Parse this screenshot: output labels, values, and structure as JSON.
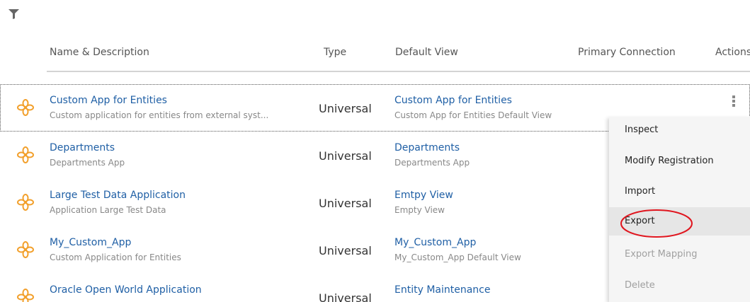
{
  "toolbar": {
    "filter_icon": "filter-icon"
  },
  "table": {
    "headers": {
      "name": "Name & Description",
      "type": "Type",
      "view": "Default View",
      "connection": "Primary Connection",
      "actions": "Actions"
    },
    "rows": [
      {
        "name": "Custom App for Entities",
        "description": "Custom application for entities from external syst...",
        "type": "Universal",
        "view_name": "Custom App for Entities",
        "view_description": "Custom App for Entities Default View",
        "selected": true
      },
      {
        "name": "Departments",
        "description": "Departments App",
        "type": "Universal",
        "view_name": "Departments",
        "view_description": "Departments App"
      },
      {
        "name": "Large Test Data Application",
        "description": "Application Large Test Data",
        "type": "Universal",
        "view_name": "Emtpy View",
        "view_description": "Empty View"
      },
      {
        "name": "My_Custom_App",
        "description": "Custom Application for Entities",
        "type": "Universal",
        "view_name": "My_Custom_App",
        "view_description": "My_Custom_App Default View"
      },
      {
        "name": "Oracle Open World Application",
        "description": "",
        "type": "Universal",
        "view_name": "Entity Maintenance",
        "view_description": ""
      }
    ],
    "app_icon": "flower-app-icon",
    "actions_icon": "kebab-menu-icon"
  },
  "context_menu": {
    "items": [
      {
        "label": "Inspect",
        "disabled": false
      },
      {
        "label": "Modify Registration",
        "disabled": false
      },
      {
        "label": "Import",
        "disabled": false
      },
      {
        "label": "Export",
        "disabled": false,
        "highlighted": true
      },
      {
        "label": "Export Mapping",
        "disabled": true
      },
      {
        "label": "Delete",
        "disabled": true
      }
    ],
    "annotation": "red-circle-around-export"
  },
  "colors": {
    "link": "#1f5fa5",
    "icon": "#f2a02c",
    "annotation": "#e0151e"
  }
}
